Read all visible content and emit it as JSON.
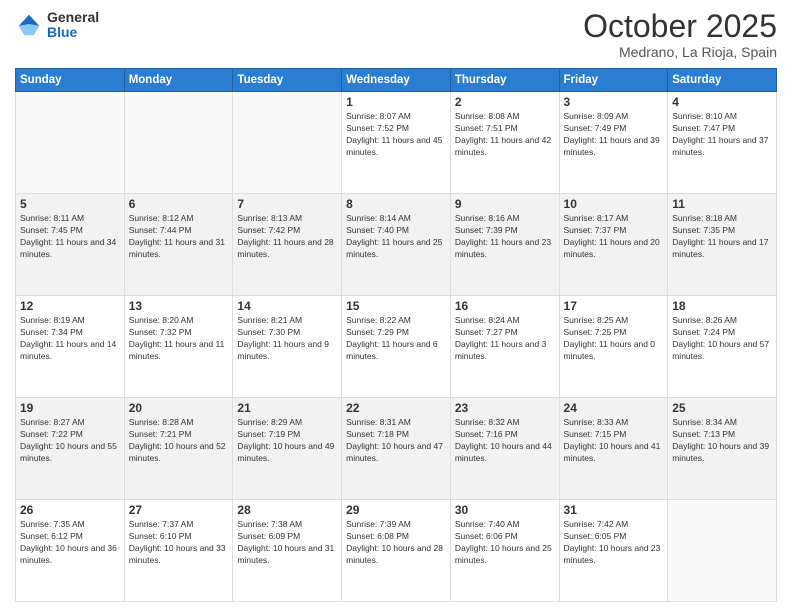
{
  "header": {
    "logo": {
      "general": "General",
      "blue": "Blue"
    },
    "title": "October 2025",
    "location": "Medrano, La Rioja, Spain"
  },
  "days_of_week": [
    "Sunday",
    "Monday",
    "Tuesday",
    "Wednesday",
    "Thursday",
    "Friday",
    "Saturday"
  ],
  "weeks": [
    [
      null,
      null,
      null,
      {
        "day": "1",
        "sunrise": "Sunrise: 8:07 AM",
        "sunset": "Sunset: 7:52 PM",
        "daylight": "Daylight: 11 hours and 45 minutes."
      },
      {
        "day": "2",
        "sunrise": "Sunrise: 8:08 AM",
        "sunset": "Sunset: 7:51 PM",
        "daylight": "Daylight: 11 hours and 42 minutes."
      },
      {
        "day": "3",
        "sunrise": "Sunrise: 8:09 AM",
        "sunset": "Sunset: 7:49 PM",
        "daylight": "Daylight: 11 hours and 39 minutes."
      },
      {
        "day": "4",
        "sunrise": "Sunrise: 8:10 AM",
        "sunset": "Sunset: 7:47 PM",
        "daylight": "Daylight: 11 hours and 37 minutes."
      }
    ],
    [
      {
        "day": "5",
        "sunrise": "Sunrise: 8:11 AM",
        "sunset": "Sunset: 7:45 PM",
        "daylight": "Daylight: 11 hours and 34 minutes."
      },
      {
        "day": "6",
        "sunrise": "Sunrise: 8:12 AM",
        "sunset": "Sunset: 7:44 PM",
        "daylight": "Daylight: 11 hours and 31 minutes."
      },
      {
        "day": "7",
        "sunrise": "Sunrise: 8:13 AM",
        "sunset": "Sunset: 7:42 PM",
        "daylight": "Daylight: 11 hours and 28 minutes."
      },
      {
        "day": "8",
        "sunrise": "Sunrise: 8:14 AM",
        "sunset": "Sunset: 7:40 PM",
        "daylight": "Daylight: 11 hours and 25 minutes."
      },
      {
        "day": "9",
        "sunrise": "Sunrise: 8:16 AM",
        "sunset": "Sunset: 7:39 PM",
        "daylight": "Daylight: 11 hours and 23 minutes."
      },
      {
        "day": "10",
        "sunrise": "Sunrise: 8:17 AM",
        "sunset": "Sunset: 7:37 PM",
        "daylight": "Daylight: 11 hours and 20 minutes."
      },
      {
        "day": "11",
        "sunrise": "Sunrise: 8:18 AM",
        "sunset": "Sunset: 7:35 PM",
        "daylight": "Daylight: 11 hours and 17 minutes."
      }
    ],
    [
      {
        "day": "12",
        "sunrise": "Sunrise: 8:19 AM",
        "sunset": "Sunset: 7:34 PM",
        "daylight": "Daylight: 11 hours and 14 minutes."
      },
      {
        "day": "13",
        "sunrise": "Sunrise: 8:20 AM",
        "sunset": "Sunset: 7:32 PM",
        "daylight": "Daylight: 11 hours and 11 minutes."
      },
      {
        "day": "14",
        "sunrise": "Sunrise: 8:21 AM",
        "sunset": "Sunset: 7:30 PM",
        "daylight": "Daylight: 11 hours and 9 minutes."
      },
      {
        "day": "15",
        "sunrise": "Sunrise: 8:22 AM",
        "sunset": "Sunset: 7:29 PM",
        "daylight": "Daylight: 11 hours and 6 minutes."
      },
      {
        "day": "16",
        "sunrise": "Sunrise: 8:24 AM",
        "sunset": "Sunset: 7:27 PM",
        "daylight": "Daylight: 11 hours and 3 minutes."
      },
      {
        "day": "17",
        "sunrise": "Sunrise: 8:25 AM",
        "sunset": "Sunset: 7:25 PM",
        "daylight": "Daylight: 11 hours and 0 minutes."
      },
      {
        "day": "18",
        "sunrise": "Sunrise: 8:26 AM",
        "sunset": "Sunset: 7:24 PM",
        "daylight": "Daylight: 10 hours and 57 minutes."
      }
    ],
    [
      {
        "day": "19",
        "sunrise": "Sunrise: 8:27 AM",
        "sunset": "Sunset: 7:22 PM",
        "daylight": "Daylight: 10 hours and 55 minutes."
      },
      {
        "day": "20",
        "sunrise": "Sunrise: 8:28 AM",
        "sunset": "Sunset: 7:21 PM",
        "daylight": "Daylight: 10 hours and 52 minutes."
      },
      {
        "day": "21",
        "sunrise": "Sunrise: 8:29 AM",
        "sunset": "Sunset: 7:19 PM",
        "daylight": "Daylight: 10 hours and 49 minutes."
      },
      {
        "day": "22",
        "sunrise": "Sunrise: 8:31 AM",
        "sunset": "Sunset: 7:18 PM",
        "daylight": "Daylight: 10 hours and 47 minutes."
      },
      {
        "day": "23",
        "sunrise": "Sunrise: 8:32 AM",
        "sunset": "Sunset: 7:16 PM",
        "daylight": "Daylight: 10 hours and 44 minutes."
      },
      {
        "day": "24",
        "sunrise": "Sunrise: 8:33 AM",
        "sunset": "Sunset: 7:15 PM",
        "daylight": "Daylight: 10 hours and 41 minutes."
      },
      {
        "day": "25",
        "sunrise": "Sunrise: 8:34 AM",
        "sunset": "Sunset: 7:13 PM",
        "daylight": "Daylight: 10 hours and 39 minutes."
      }
    ],
    [
      {
        "day": "26",
        "sunrise": "Sunrise: 7:35 AM",
        "sunset": "Sunset: 6:12 PM",
        "daylight": "Daylight: 10 hours and 36 minutes."
      },
      {
        "day": "27",
        "sunrise": "Sunrise: 7:37 AM",
        "sunset": "Sunset: 6:10 PM",
        "daylight": "Daylight: 10 hours and 33 minutes."
      },
      {
        "day": "28",
        "sunrise": "Sunrise: 7:38 AM",
        "sunset": "Sunset: 6:09 PM",
        "daylight": "Daylight: 10 hours and 31 minutes."
      },
      {
        "day": "29",
        "sunrise": "Sunrise: 7:39 AM",
        "sunset": "Sunset: 6:08 PM",
        "daylight": "Daylight: 10 hours and 28 minutes."
      },
      {
        "day": "30",
        "sunrise": "Sunrise: 7:40 AM",
        "sunset": "Sunset: 6:06 PM",
        "daylight": "Daylight: 10 hours and 25 minutes."
      },
      {
        "day": "31",
        "sunrise": "Sunrise: 7:42 AM",
        "sunset": "Sunset: 6:05 PM",
        "daylight": "Daylight: 10 hours and 23 minutes."
      },
      null
    ]
  ]
}
